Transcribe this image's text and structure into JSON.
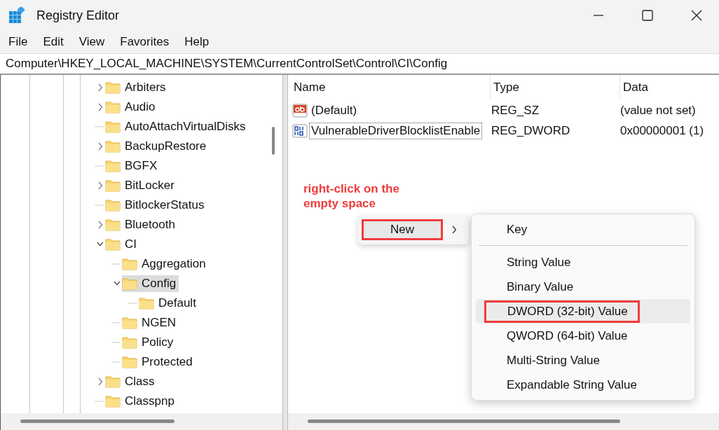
{
  "window": {
    "title": "Registry Editor"
  },
  "menu_bar": [
    "File",
    "Edit",
    "View",
    "Favorites",
    "Help"
  ],
  "address_bar": {
    "value": "Computer\\HKEY_LOCAL_MACHINE\\SYSTEM\\CurrentControlSet\\Control\\CI\\Config"
  },
  "tree": [
    {
      "label": "Arbiters",
      "expandable": true,
      "expanded": false,
      "selected": false
    },
    {
      "label": "Audio",
      "expandable": true,
      "expanded": false,
      "selected": false
    },
    {
      "label": "AutoAttachVirtualDisks",
      "expandable": false,
      "expanded": false,
      "selected": false
    },
    {
      "label": "BackupRestore",
      "expandable": true,
      "expanded": false,
      "selected": false
    },
    {
      "label": "BGFX",
      "expandable": false,
      "expanded": false,
      "selected": false
    },
    {
      "label": "BitLocker",
      "expandable": true,
      "expanded": false,
      "selected": false
    },
    {
      "label": "BitlockerStatus",
      "expandable": false,
      "expanded": false,
      "selected": false
    },
    {
      "label": "Bluetooth",
      "expandable": true,
      "expanded": false,
      "selected": false
    },
    {
      "label": "CI",
      "expandable": true,
      "expanded": true,
      "selected": false,
      "children": [
        {
          "label": "Aggregation",
          "expandable": false,
          "expanded": false,
          "selected": false
        },
        {
          "label": "Config",
          "expandable": true,
          "expanded": true,
          "selected": true,
          "children": [
            {
              "label": "Default",
              "expandable": false,
              "expanded": false,
              "selected": false
            }
          ]
        },
        {
          "label": "NGEN",
          "expandable": false,
          "expanded": false,
          "selected": false
        },
        {
          "label": "Policy",
          "expandable": false,
          "expanded": false,
          "selected": false
        },
        {
          "label": "Protected",
          "expandable": false,
          "expanded": false,
          "selected": false
        }
      ]
    },
    {
      "label": "Class",
      "expandable": true,
      "expanded": false,
      "selected": false
    },
    {
      "label": "Classpnp",
      "expandable": false,
      "expanded": false,
      "selected": false
    }
  ],
  "values_table": {
    "columns": [
      "Name",
      "Type",
      "Data"
    ],
    "rows": [
      {
        "kind": "string",
        "name": "(Default)",
        "type": "REG_SZ",
        "data": "(value not set)",
        "focused": false
      },
      {
        "kind": "binary",
        "name": "VulnerableDriverBlocklistEnable",
        "type": "REG_DWORD",
        "data": "0x00000001 (1)",
        "focused": true
      }
    ]
  },
  "annotation": "right-click on the empty space",
  "context_menu": {
    "items": [
      {
        "label": "New",
        "highlighted": true,
        "has_submenu": true
      }
    ]
  },
  "submenu": {
    "items": [
      {
        "kind": "item",
        "label": "Key",
        "selected": false,
        "highlighted": false
      },
      {
        "kind": "separator"
      },
      {
        "kind": "item",
        "label": "String Value",
        "selected": false,
        "highlighted": false
      },
      {
        "kind": "item",
        "label": "Binary Value",
        "selected": false,
        "highlighted": false
      },
      {
        "kind": "item",
        "label": "DWORD (32-bit) Value",
        "selected": true,
        "highlighted": true
      },
      {
        "kind": "item",
        "label": "QWORD (64-bit) Value",
        "selected": false,
        "highlighted": false
      },
      {
        "kind": "item",
        "label": "Multi-String Value",
        "selected": false,
        "highlighted": false
      },
      {
        "kind": "item",
        "label": "Expandable String Value",
        "selected": false,
        "highlighted": false
      }
    ]
  }
}
